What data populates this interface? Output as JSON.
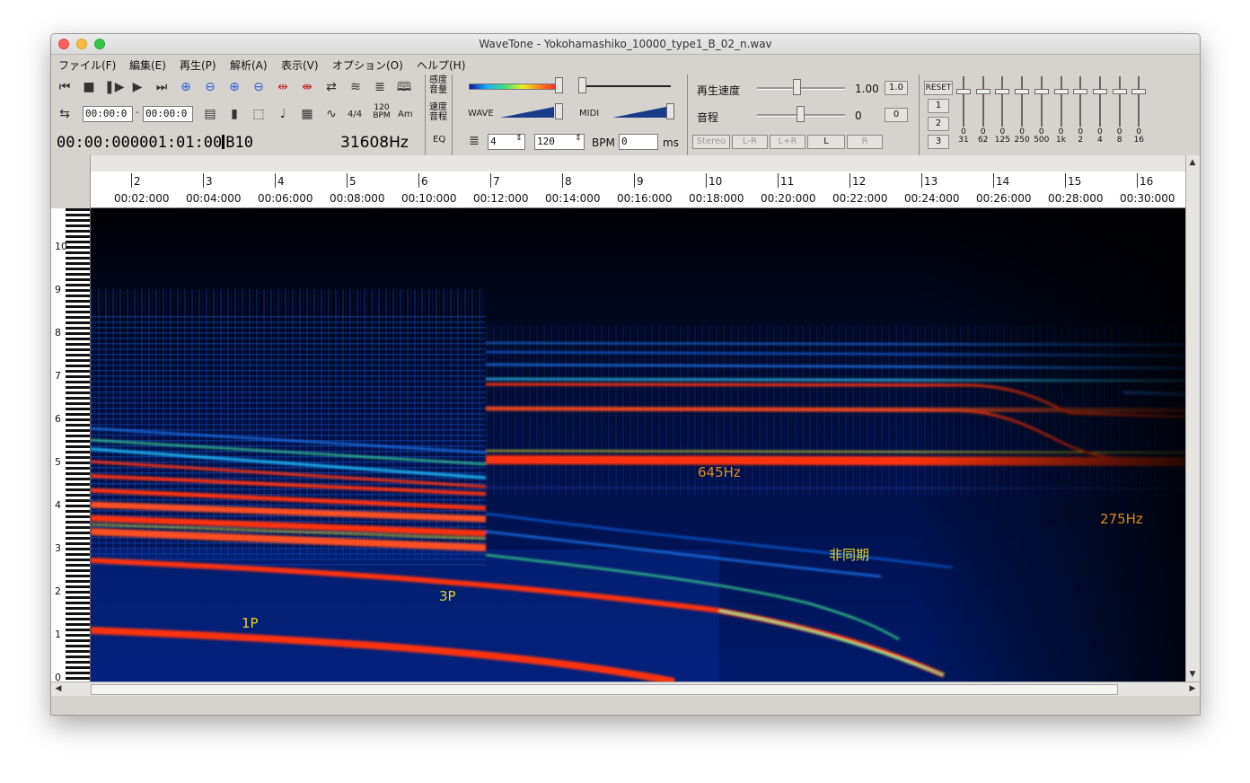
{
  "window": {
    "title": "WaveTone - Yokohamashiko_10000_type1_B_02_n.wav"
  },
  "menu": [
    "ファイル(F)",
    "編集(E)",
    "再生(P)",
    "解析(A)",
    "表示(V)",
    "オプション(O)",
    "ヘルプ(H)"
  ],
  "toolbar": {
    "start_time": "00:00:0",
    "end_time": "00:00:0",
    "time_sig": "4/4",
    "bpm_small_top": "120",
    "bpm_small_bottom": "BPM",
    "chord_label": "Am",
    "position_readout": "00:00:000001:01:00",
    "note_readout": "B10",
    "freq_readout": "31608Hz",
    "sensitivity_label_1": "感度",
    "sensitivity_label_2": "音量",
    "speed_label_1": "速度",
    "speed_label_2": "音程",
    "eq_label": "EQ",
    "wave_label": "WAVE",
    "midi_label": "MIDI",
    "beat_value": "4",
    "bpm_value": "120",
    "bpm_label": "BPM",
    "ms_value": "0",
    "ms_label": "ms"
  },
  "playback": {
    "speed_label": "再生速度",
    "speed_value": "1.00",
    "speed_reset": "1.0",
    "pitch_label": "音程",
    "pitch_value": "0",
    "pitch_reset": "0",
    "channel_buttons": [
      "Stereo",
      "L-R",
      "L+R",
      "L",
      "R"
    ]
  },
  "equalizer": {
    "reset_label": "RESET",
    "presets": [
      "1",
      "2",
      "3"
    ],
    "values": [
      "0",
      "0",
      "0",
      "0",
      "0",
      "0",
      "0",
      "0",
      "0",
      "0"
    ],
    "bands": [
      "31",
      "62",
      "125",
      "250",
      "500",
      "1k",
      "2",
      "4",
      "8",
      "16"
    ]
  },
  "ruler": {
    "bars": [
      "2",
      "3",
      "4",
      "5",
      "6",
      "7",
      "8",
      "9",
      "10",
      "11",
      "12",
      "13",
      "14",
      "15",
      "16"
    ],
    "times": [
      "00:02:000",
      "00:04:000",
      "00:06:000",
      "00:08:000",
      "00:10:000",
      "00:12:000",
      "00:14:000",
      "00:16:000",
      "00:18:000",
      "00:20:000",
      "00:22:000",
      "00:24:000",
      "00:26:000",
      "00:28:000",
      "00:30:000"
    ]
  },
  "piano": {
    "octaves": [
      "10",
      "9",
      "8",
      "7",
      "6",
      "5",
      "4",
      "3",
      "2",
      "1",
      "0"
    ]
  },
  "annotations": {
    "freq_645": "645Hz",
    "freq_275": "275Hz",
    "async": "非同期",
    "p3": "3P",
    "p1": "1P"
  },
  "colors": {
    "annot_yellow": "#e8d020",
    "annot_orange": "#e08a18",
    "band_red": "#ff3010"
  }
}
